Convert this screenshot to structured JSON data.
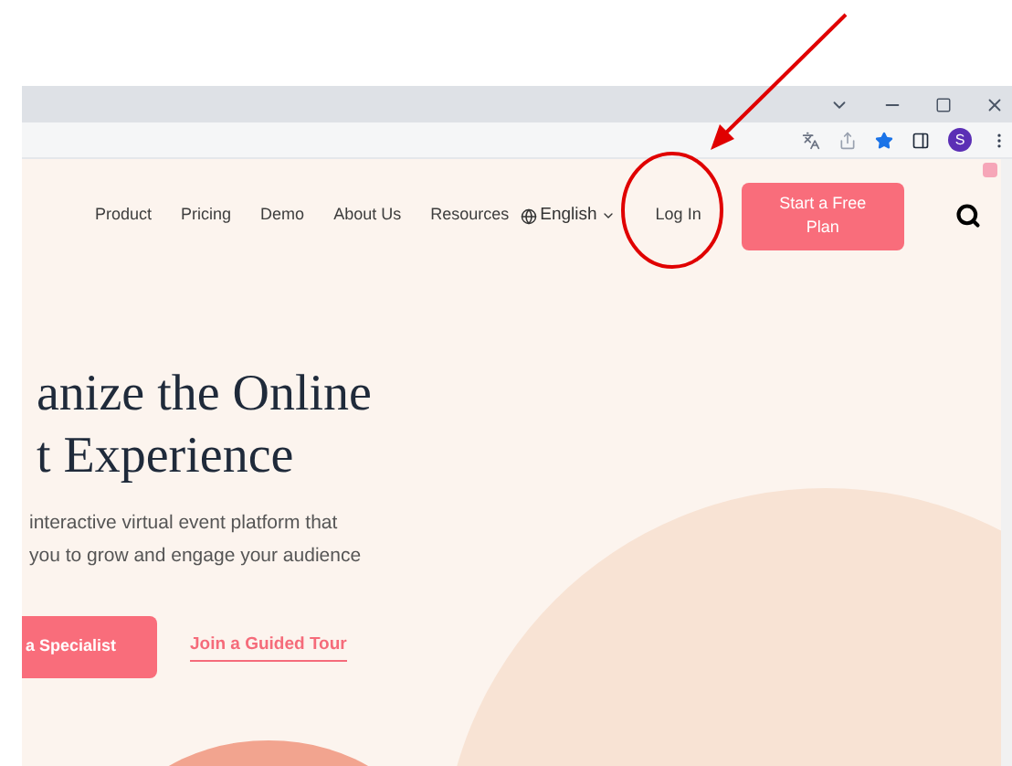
{
  "browser": {
    "avatar": "S"
  },
  "nav": {
    "items": [
      "Product",
      "Pricing",
      "Demo",
      "About Us",
      "Resources"
    ],
    "language": "English",
    "login": "Log In",
    "cta": "Start a Free Plan"
  },
  "hero": {
    "title_lines": [
      "anize the Online",
      "t Experience"
    ],
    "text_lines": [
      "interactive virtual event platform that",
      "you to grow and engage your audience"
    ],
    "primary_button": "a Specialist",
    "secondary_link": "Join a Guided Tour"
  }
}
